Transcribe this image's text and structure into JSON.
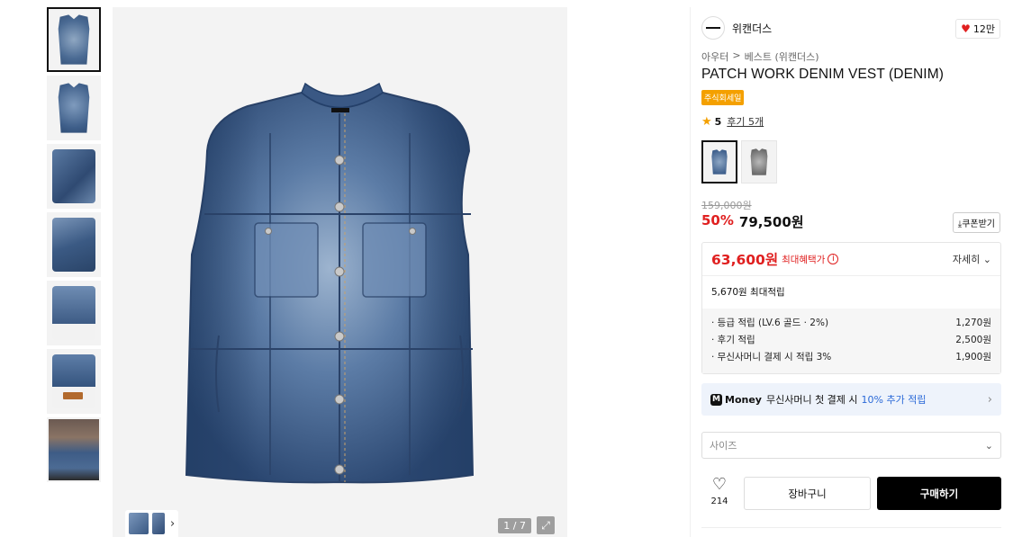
{
  "gallery": {
    "counter": "1 / 7",
    "thumbnails": [
      "vest-front",
      "vest-back",
      "vest-collar-detail",
      "vest-pocket-detail",
      "vest-hem-detail",
      "vest-label-detail",
      "model-wearing"
    ]
  },
  "brand": {
    "name": "위캔더스",
    "likes": "12만"
  },
  "breadcrumb": {
    "category": "아우터",
    "separator": ">",
    "subcategory": "베스트 (위캔더스)"
  },
  "product": {
    "title": "PATCH WORK DENIM VEST (DENIM)",
    "sale_tag": "주식회세일",
    "rating": "5",
    "reviews": "후기 5개",
    "colors": [
      "denim",
      "grey"
    ]
  },
  "price": {
    "original": "159,000원",
    "discount": "50%",
    "sale": "79,500원",
    "coupon_label": "쿠폰받기"
  },
  "benefit": {
    "max_price": "63,600원",
    "max_label": "최대혜택가",
    "info_icon": "i",
    "detail_label": "자세히",
    "points_total": "5,670원 최대적립",
    "items": [
      {
        "label": "· 등급 적립 (LV.6 골드 · 2%)",
        "value": "1,270원"
      },
      {
        "label": "· 후기 적립",
        "value": "2,500원"
      },
      {
        "label": "· 무신사머니 결제 시 적립 3%",
        "value": "1,900원"
      }
    ]
  },
  "money_banner": {
    "logo": "M",
    "brand": "Money",
    "text": "무신사머니 첫 결제 시",
    "highlight": "10% 추가 적립"
  },
  "size": {
    "placeholder": "사이즈"
  },
  "actions": {
    "wish_count": "214",
    "cart": "장바구니",
    "buy": "구매하기"
  },
  "colors": {
    "accent_red": "#e02020",
    "sale_tag": "#f4a000",
    "money_blue": "#2b6ad8",
    "buy_bg": "#000000"
  }
}
